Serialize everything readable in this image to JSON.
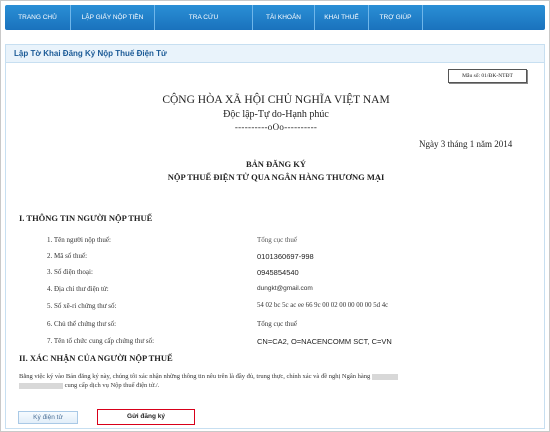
{
  "nav": {
    "items": [
      {
        "label": "TRANG CHỦ"
      },
      {
        "label": "LẬP GIẤY NỘP TIỀN"
      },
      {
        "label": "TRA CỨU"
      },
      {
        "label": "TÀI KHOẢN"
      },
      {
        "label": "KHAI THUẾ"
      },
      {
        "label": "TRỢ GIÚP"
      }
    ]
  },
  "page": {
    "title": "Lập Tờ Khai Đăng Ký Nộp Thuế Điện Tử"
  },
  "document": {
    "form_code": "Mẫu số: 01/ĐK-NTĐT",
    "nation": "CỘNG HÒA XÃ HỘI CHỦ NGHĨA VIỆT NAM",
    "motto": "Độc lập-Tự do-Hạnh phúc",
    "separator": "----------oOo----------",
    "date": "Ngày 3 tháng 1 năm 2014",
    "heading_line1": "BẢN ĐĂNG KÝ",
    "heading_line2": "NỘP THUẾ ĐIỆN TỬ QUA NGÂN HÀNG THƯƠNG MẠI",
    "section1_title": "I. THÔNG TIN NGƯỜI NỘP THUẾ",
    "fields": [
      {
        "label": "1. Tên người nộp thuế:",
        "value": "Tổng cục thuế"
      },
      {
        "label": "2. Mã số thuế:",
        "value": "0101360697-998"
      },
      {
        "label": "3. Số điện thoại:",
        "value": "0945854540"
      },
      {
        "label": "4. Địa chỉ thư điện tử:",
        "value": "dungkt@gmail.com"
      },
      {
        "label": "5. Số xê-ri chứng thư số:",
        "value": "54 02 bc 5c ac ee 66 9c 00 02 00 00 00 00 5d 4c"
      },
      {
        "label": "6. Chủ thể chứng thư số:",
        "value": "Tổng cục thuế"
      },
      {
        "label": "7. Tên tổ chức cung cấp chứng thư số:",
        "value": "CN=CA2, O=NACENCOMM SCT, C=VN"
      }
    ],
    "section2_title": "II. XÁC NHẬN CỦA NGƯỜI NỘP THUẾ",
    "confirm_part1": "Bằng việc ký vào Bản đăng ký này, chúng tôi xác nhận những thông tin nêu trên là đầy đủ, trung thực, chính xác và đề nghị Ngân hàng",
    "confirm_part2": "cung cấp dịch vụ Nộp thuế điện tử./."
  },
  "actions": {
    "sign_label": "Ký điện tử",
    "send_label": "Gửi đăng ký"
  }
}
